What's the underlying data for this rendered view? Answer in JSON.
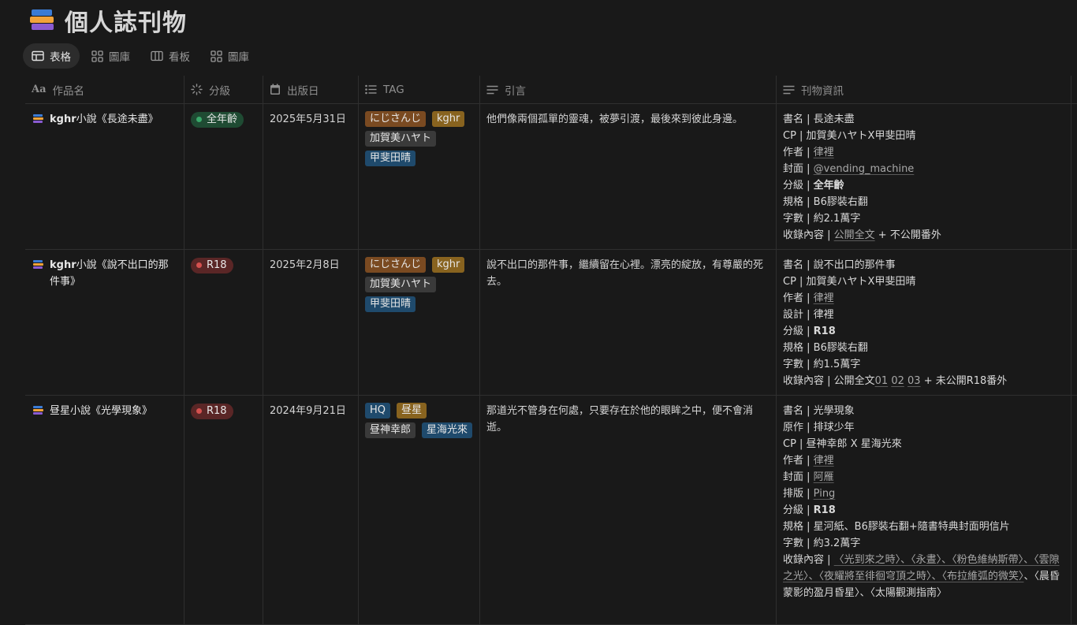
{
  "page": {
    "title": "個人誌刊物"
  },
  "views": [
    {
      "label": "表格",
      "icon": "table-icon",
      "active": true
    },
    {
      "label": "圖庫",
      "icon": "gallery-icon",
      "active": false
    },
    {
      "label": "看板",
      "icon": "board-icon",
      "active": false
    },
    {
      "label": "圖庫",
      "icon": "gallery-icon",
      "active": false
    }
  ],
  "columns": {
    "name": "作品名",
    "rating": "分級",
    "date": "出版日",
    "tag": "TAG",
    "quote": "引言",
    "info": "刊物資訊"
  },
  "rows": [
    {
      "name_prefix": "kghr",
      "name_rest": "小說《長途未盡》",
      "rating": "全年齡",
      "date": "2025年5月31日",
      "tags": [
        "にじさんじ",
        "kghr",
        "加賀美ハヤト",
        "甲斐田晴"
      ],
      "quote": "他們像兩個孤單的靈魂，被夢引渡，最後來到彼此身邊。",
      "info": {
        "l1": "書名 | 長途未盡",
        "l2": "CP | 加賀美ハヤトX甲斐田晴",
        "l3a": "作者 | ",
        "l3b": "律裡",
        "l4a": "封面 | ",
        "l4b": "@vending_machine",
        "l5a": "分級 | ",
        "l5b": "全年齡",
        "l6": "規格 | B6膠裝右翻",
        "l7": "字數 | 約2.1萬字",
        "l8a": "收錄內容 | ",
        "l8b": "公開全文",
        "l8c": " + 不公開番外"
      }
    },
    {
      "name_prefix": "kghr",
      "name_rest": "小說《說不出口的那件事》",
      "rating": "R18",
      "date": "2025年2月8日",
      "tags": [
        "にじさんじ",
        "kghr",
        "加賀美ハヤト",
        "甲斐田晴"
      ],
      "quote": "說不出口的那件事，繼續留在心裡。漂亮的綻放，有尊嚴的死去。",
      "info": {
        "l1": "書名 | 說不出口的那件事",
        "l2": "CP | 加賀美ハヤトX甲斐田晴",
        "l3a": "作者 | ",
        "l3b": "律裡",
        "l4": "設計 | 律裡",
        "l5a": "分級 | ",
        "l5b": "R18",
        "l6": "規格 | B6膠裝右翻",
        "l7": "字數 | 約1.5萬字",
        "l8a": "收錄內容 | 公開全文",
        "l8b": "01",
        "l8c": "02",
        "l8d": "03",
        "l8e": " + 未公開R18番外"
      }
    },
    {
      "name_prefix": "",
      "name_rest": "昼星小說《光學現象》",
      "rating": "R18",
      "date": "2024年9月21日",
      "tags": [
        "HQ",
        "昼星",
        "昼神幸郎",
        "星海光來"
      ],
      "quote": "那道光不管身在何處，只要存在於他的眼眸之中，便不會消逝。",
      "info": {
        "l1": "書名 | 光學現象",
        "l2": "原作 | 排球少年",
        "l3": "CP | 昼神幸郎 X 星海光來",
        "l4a": "作者 | ",
        "l4b": "律裡",
        "l5a": "封面 | ",
        "l5b": "阿雁",
        "l6a": "排版 | ",
        "l6b": "Ping",
        "l7a": "分級 | ",
        "l7b": "R18",
        "l8": "規格 | 星河紙、B6膠裝右翻+隨書特典封面明信片",
        "l9": "字數 | 約3.2萬字",
        "l10a": "收錄內容 | ",
        "l10b": "〈光到來之時〉、〈永晝〉、〈粉色維納斯帶〉、〈雲隙之光〉、〈夜耀將至徘徊穹頂之時〉、〈布拉維弧的微笑〉",
        "l10c": "、〈晨昏蒙影的盈月昏星〉、〈太陽觀測指南〉"
      }
    }
  ],
  "colors": {
    "background": "#191919",
    "tag_brown": "#7a4a21",
    "tag_gold": "#88631f",
    "tag_gray": "#3a3a3a",
    "tag_blue": "#1f4a6c",
    "status_green": "#1f4b33",
    "status_red": "#5a2626"
  }
}
